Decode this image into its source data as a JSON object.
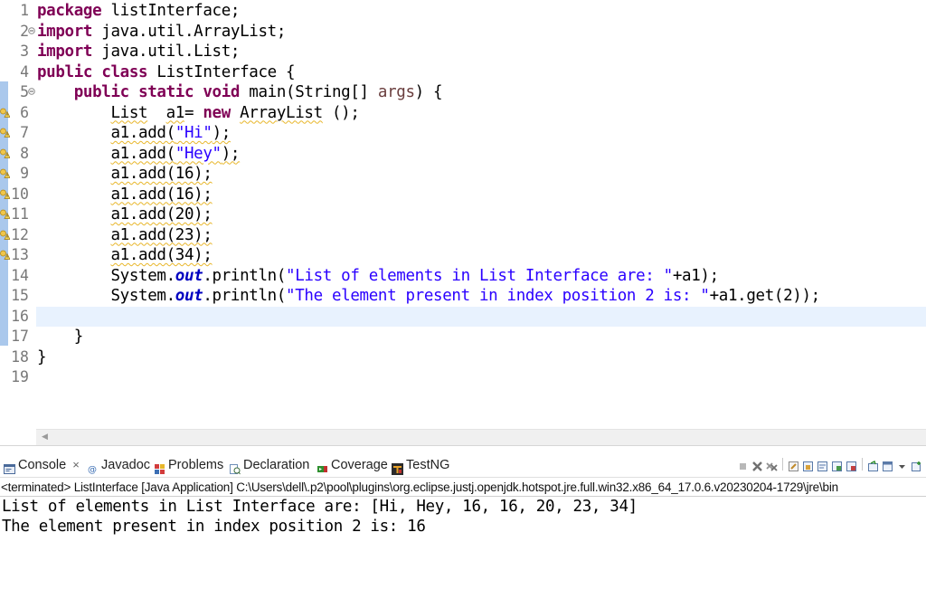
{
  "editor": {
    "line_numbers": [
      "1",
      "2",
      "3",
      "4",
      "5",
      "6",
      "7",
      "8",
      "9",
      "10",
      "11",
      "12",
      "13",
      "14",
      "15",
      "16",
      "17",
      "18",
      "19"
    ],
    "lines": [
      [
        {
          "t": "package",
          "c": "kw"
        },
        {
          "t": " listInterface;"
        }
      ],
      [
        {
          "t": "import",
          "c": "kw"
        },
        {
          "t": " java.util.ArrayList;"
        }
      ],
      [
        {
          "t": "import",
          "c": "kw"
        },
        {
          "t": " java.util.List;"
        }
      ],
      [
        {
          "t": "public",
          "c": "kw"
        },
        {
          "t": " "
        },
        {
          "t": "class",
          "c": "kw"
        },
        {
          "t": " ListInterface {"
        }
      ],
      [
        {
          "t": "    "
        },
        {
          "t": "public",
          "c": "kw"
        },
        {
          "t": " "
        },
        {
          "t": "static",
          "c": "kw"
        },
        {
          "t": " "
        },
        {
          "t": "void",
          "c": "kw"
        },
        {
          "t": " main(String[] "
        },
        {
          "t": "args",
          "c": "param"
        },
        {
          "t": ") {"
        }
      ],
      [
        {
          "t": "        "
        },
        {
          "t": "List",
          "c": "wavy"
        },
        {
          "t": "  "
        },
        {
          "t": "a1",
          "c": "wavy"
        },
        {
          "t": "= "
        },
        {
          "t": "new",
          "c": "kw"
        },
        {
          "t": " "
        },
        {
          "t": "ArrayList",
          "c": "wavy"
        },
        {
          "t": " ();"
        }
      ],
      [
        {
          "t": "        "
        },
        {
          "t": "a1.add(\"Hi\");",
          "c": "wavy",
          "inner": [
            {
              "t": "a1.add("
            },
            {
              "t": "\"Hi\"",
              "c": "str"
            },
            {
              "t": ");"
            }
          ]
        }
      ],
      [
        {
          "t": "        "
        },
        {
          "t": "a1.add(\"Hey\");",
          "c": "wavy",
          "inner": [
            {
              "t": "a1.add("
            },
            {
              "t": "\"Hey\"",
              "c": "str"
            },
            {
              "t": ");"
            }
          ]
        }
      ],
      [
        {
          "t": "        "
        },
        {
          "t": "a1.add(16);",
          "c": "wavy"
        }
      ],
      [
        {
          "t": "        "
        },
        {
          "t": "a1.add(16);",
          "c": "wavy"
        }
      ],
      [
        {
          "t": "        "
        },
        {
          "t": "a1.add(20);",
          "c": "wavy"
        }
      ],
      [
        {
          "t": "        "
        },
        {
          "t": "a1.add(23);",
          "c": "wavy"
        }
      ],
      [
        {
          "t": "        "
        },
        {
          "t": "a1.add(34);",
          "c": "wavy"
        }
      ],
      [
        {
          "t": "        System."
        },
        {
          "t": "out",
          "c": "fld"
        },
        {
          "t": ".println("
        },
        {
          "t": "\"List of elements in List Interface are: \"",
          "c": "str"
        },
        {
          "t": "+a1);"
        }
      ],
      [
        {
          "t": "        System."
        },
        {
          "t": "out",
          "c": "fld"
        },
        {
          "t": ".println("
        },
        {
          "t": "\"The element present in index position 2 is: \"",
          "c": "str"
        },
        {
          "t": "+a1.get(2));"
        }
      ],
      [
        {
          "t": ""
        }
      ],
      [
        {
          "t": "    }"
        }
      ],
      [
        {
          "t": "}"
        }
      ],
      [
        {
          "t": ""
        }
      ]
    ],
    "fold_lines": [
      2,
      5
    ],
    "warning_lines": [
      6,
      7,
      8,
      9,
      10,
      11,
      12,
      13
    ],
    "current_line": 16
  },
  "console": {
    "tabs": [
      {
        "id": "tab-console",
        "label": "Console",
        "icon": "console-icon",
        "closable": true,
        "active": true
      },
      {
        "id": "tab-javadoc",
        "label": "Javadoc",
        "icon": "javadoc-icon"
      },
      {
        "id": "tab-problems",
        "label": "Problems",
        "icon": "problems-icon"
      },
      {
        "id": "tab-declaration",
        "label": "Declaration",
        "icon": "declaration-icon"
      },
      {
        "id": "tab-coverage",
        "label": "Coverage",
        "icon": "coverage-icon"
      },
      {
        "id": "tab-testng",
        "label": "TestNG",
        "icon": "testng-icon"
      }
    ],
    "close_glyph": "×",
    "header": "<terminated> ListInterface [Java Application] C:\\Users\\dell\\.p2\\pool\\plugins\\org.eclipse.justj.openjdk.hotspot.jre.full.win32.x86_64_17.0.6.v20230204-1729\\jre\\bin",
    "output": [
      "List of elements in List Interface are: [Hi, Hey, 16, 16, 20, 23, 34]",
      "The element present in index position 2 is: 16"
    ]
  },
  "colors": {
    "keyword": "#7f0055",
    "string": "#2a00ff",
    "static_field": "#0000c0",
    "current_line": "#e8f2fe",
    "warning_underline": "#e8b62a"
  }
}
